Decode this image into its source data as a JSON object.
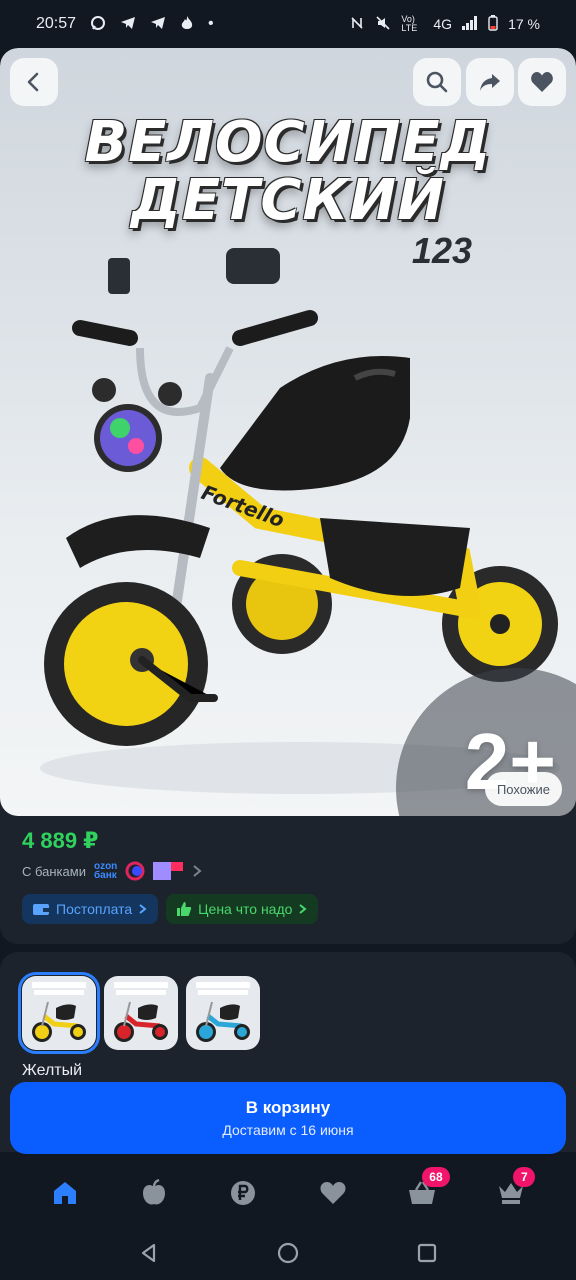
{
  "status": {
    "time": "20:57",
    "network": "4G",
    "volte": "Vo) LTE",
    "battery": "17 %"
  },
  "hero": {
    "title_line1": "ВЕЛОСИПЕД",
    "title_line2": "ДЕТСКИЙ",
    "model": "123",
    "age": "2+",
    "similar_label": "Похожие",
    "back_icon": "back-arrow-icon",
    "search_icon": "search-icon",
    "share_icon": "share-icon",
    "fav_icon": "heart-icon"
  },
  "product": {
    "price": "4 889 ₽",
    "banks_label": "С банками",
    "ozon_bank_line1": "ozon",
    "ozon_bank_line2": "банк",
    "chip_postpay": "Постоплата",
    "chip_price": "Цена что надо"
  },
  "variants": {
    "items": [
      {
        "color": "#f0cf14",
        "selected": true
      },
      {
        "color": "#d8232a",
        "selected": false
      },
      {
        "color": "#2aa7d8",
        "selected": false
      }
    ],
    "selected_label": "Желтый"
  },
  "cart": {
    "title": "В корзину",
    "subtitle": "Доставим с 16 июня"
  },
  "nav": {
    "cart_badge": "68",
    "profile_badge": "7"
  },
  "colors": {
    "accent": "#0a5dff",
    "price": "#2fd25c",
    "badge": "#f0156a"
  }
}
